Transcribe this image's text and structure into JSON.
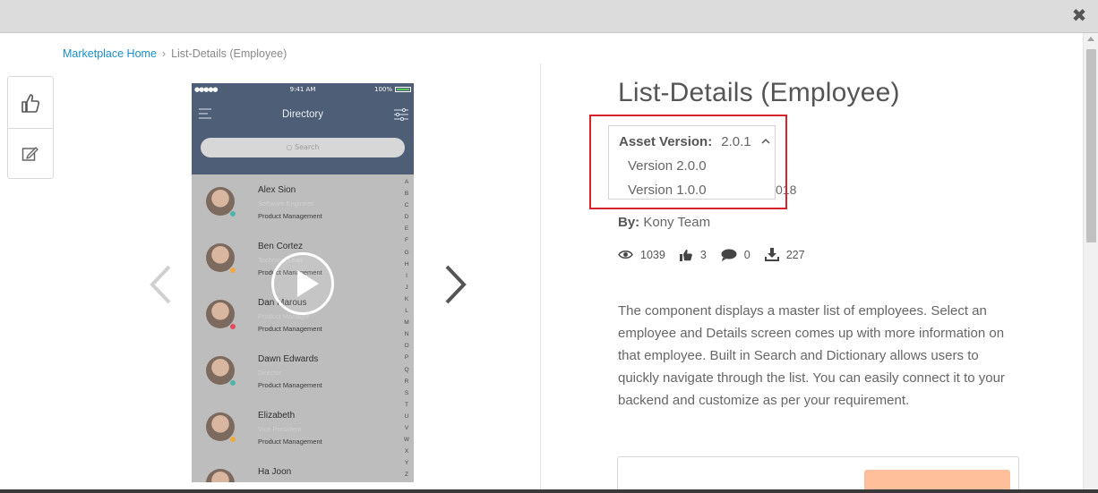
{
  "window": {
    "close_label": "✖"
  },
  "breadcrumb": {
    "home": "Marketplace Home",
    "separator": "›",
    "current": "List-Details (Employee)"
  },
  "actions": {
    "like_icon": "thumbs-up-icon",
    "edit_icon": "edit-note-icon"
  },
  "preview": {
    "status_time": "9:41 AM",
    "status_battery": "100%",
    "status_signal": "●●●●●",
    "app_title": "Directory",
    "search_placeholder": "Search",
    "alphabet": [
      "A",
      "B",
      "C",
      "D",
      "E",
      "F",
      "G",
      "H",
      "I",
      "J",
      "K",
      "L",
      "M",
      "N",
      "O",
      "P",
      "Q",
      "R",
      "S",
      "T",
      "U",
      "V",
      "W",
      "X",
      "Y",
      "Z"
    ],
    "contacts": [
      {
        "name": "Alex Sion",
        "role": "Software Engineer",
        "dept": "Product Management",
        "status_color": "#4db6ac"
      },
      {
        "name": "Ben Cortez",
        "role": "Technical Lead",
        "dept": "Product Management",
        "status_color": "#f0a93b"
      },
      {
        "name": "Dan Marous",
        "role": "Product Manager",
        "dept": "Product Management",
        "status_color": "#e34b5a"
      },
      {
        "name": "Dawn Edwards",
        "role": "Director",
        "dept": "Product Management",
        "status_color": "#4db6ac"
      },
      {
        "name": "Elizabeth",
        "role": "Vice President",
        "dept": "Product Management",
        "status_color": "#f0a93b"
      },
      {
        "name": "Ha Joon",
        "role": "",
        "dept": "",
        "status_color": ""
      }
    ]
  },
  "asset": {
    "title": "List-Details (Employee)",
    "version_label": "Asset Version:",
    "version_value": "2.0.1",
    "version_options": [
      "Version 2.0.0",
      "Version 1.0.0"
    ],
    "date_peek": "018",
    "by_label": "By:",
    "author": "Kony Team",
    "stats": {
      "views": "1039",
      "likes": "3",
      "comments": "0",
      "downloads": "227"
    },
    "description": "The component displays a master list of employees. Select an employee and Details screen comes up with more information on that employee. Built in Search and Dictionary allows users to quickly navigate through the list. You can easily connect it to your backend and customize as per your requirement."
  },
  "colors": {
    "link": "#1a8fc9",
    "highlight": "#d8232a",
    "cta": "#ffbf9a",
    "phone_header": "#4d5e76"
  }
}
